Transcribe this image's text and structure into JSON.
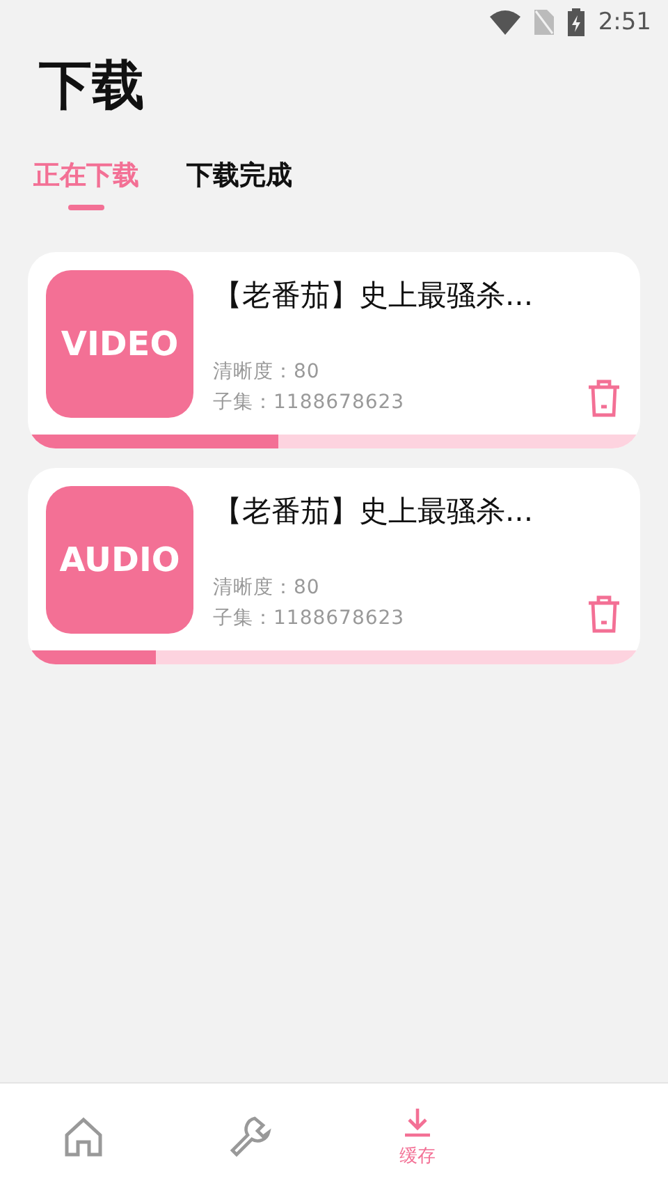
{
  "status_bar": {
    "time": "2:51"
  },
  "title": "下载",
  "tabs": [
    {
      "label": "正在下载",
      "selected": true
    },
    {
      "label": "下载完成",
      "selected": false
    }
  ],
  "downloads": [
    {
      "badge": "VIDEO",
      "title": "【老番茄】史上最骚杀...",
      "quality": "清晰度：80",
      "episode": "子集：1188678623",
      "level": 0.41
    },
    {
      "badge": "AUDIO",
      "title": "【老番茄】史上最骚杀...",
      "quality": "清晰度：80",
      "episode": "子集：1188678623",
      "level": 0.21
    }
  ],
  "nav": [
    {
      "kind": "home",
      "selected": false
    },
    {
      "kind": "tools",
      "selected": false
    },
    {
      "kind": "cache",
      "label": "缓存",
      "selected": true
    }
  ]
}
